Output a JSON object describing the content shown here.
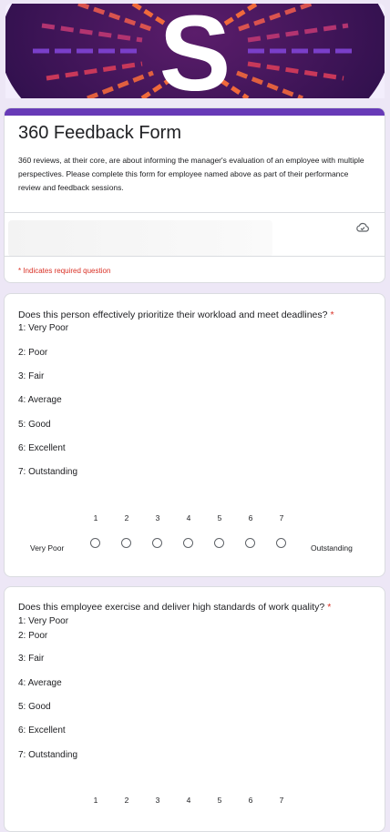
{
  "header": {
    "logo_letter": "S",
    "title": "360 Feedback Form",
    "description": "360 reviews, at their core, are about informing the manager's evaluation of an employee with multiple perspectives. Please complete this form for employee named above as part of their performance review and feedback sessions.",
    "required_note": "* Indicates required question",
    "cloud_icon": "cloud-saved-icon",
    "accent_color": "#673ab7"
  },
  "questions": [
    {
      "title": "Does this person effectively prioritize their workload and meet deadlines?",
      "required_mark": "*",
      "options": [
        "1: Very Poor",
        "2: Poor",
        "3: Fair",
        "4: Average",
        "5: Good",
        "6: Excellent",
        "7: Outstanding"
      ],
      "scale": [
        "1",
        "2",
        "3",
        "4",
        "5",
        "6",
        "7"
      ],
      "scale_low": "Very Poor",
      "scale_high": "Outstanding"
    },
    {
      "title": "Does this employee exercise and deliver high standards of work quality?",
      "required_mark": "*",
      "options": [
        "1: Very Poor",
        "2: Poor",
        "3: Fair",
        "4: Average",
        "5: Good",
        "6: Excellent",
        "7: Outstanding"
      ],
      "scale": [
        "1",
        "2",
        "3",
        "4",
        "5",
        "6",
        "7"
      ]
    }
  ]
}
